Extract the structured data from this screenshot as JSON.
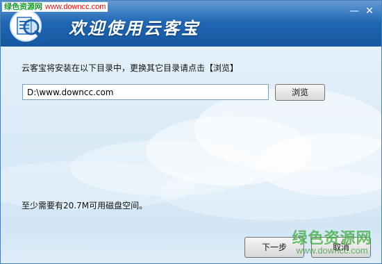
{
  "watermark_top": {
    "site_name": "绿色资源网",
    "url": "www.downcc.com"
  },
  "window": {
    "title": "欢迎使用云客宝",
    "minimize_glyph": "—",
    "close_glyph": "✕"
  },
  "logo": {
    "icon": "magnifier-document-icon"
  },
  "install": {
    "instruction": "云客宝将安装在以下目录中，更换其它目录请点击【浏览】",
    "path_value": "D:\\www.downcc.com",
    "browse_label": "浏览",
    "space_note": "至少需要有20.7M可用磁盘空间。"
  },
  "footer": {
    "next_label": "下一步",
    "cancel_label": "取消"
  },
  "watermark_bottom": {
    "site_name": "绿色资源网",
    "url": "www.downcc.com"
  },
  "colors": {
    "header": "#1e64b0",
    "body_top": "#e9f3fb",
    "body_bottom": "#cfe4f5",
    "watermark_green": "#1a9a2a",
    "watermark_red": "#cc1111"
  }
}
